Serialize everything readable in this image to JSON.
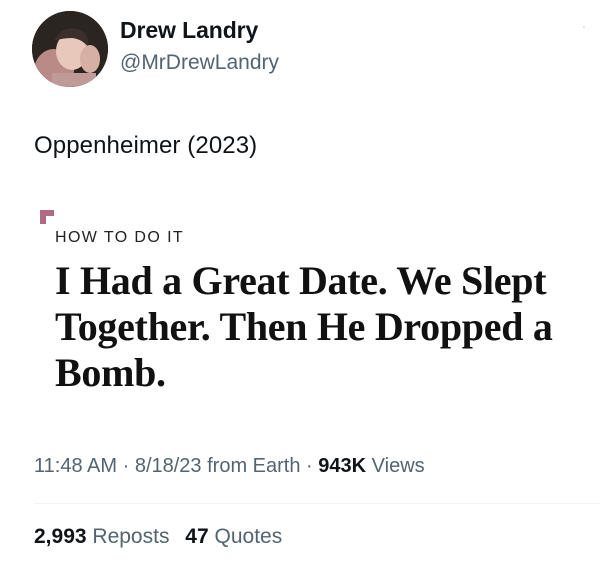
{
  "author": {
    "display_name": "Drew Landry",
    "handle": "@MrDrewLandry"
  },
  "tweet": {
    "text": "Oppenheimer (2023)"
  },
  "article": {
    "kicker": "HOW TO DO IT",
    "headline": "I Had a Great Date. We Slept Together. Then He Dropped a Bomb."
  },
  "meta": {
    "time": "11:48 AM",
    "date": "8/18/23",
    "source": "from Earth",
    "views_count": "943K",
    "views_label": "Views",
    "separator": "·"
  },
  "stats": {
    "reposts_count": "2,993",
    "reposts_label": "Reposts",
    "quotes_count": "47",
    "quotes_label": "Quotes"
  },
  "colors": {
    "kicker_mark": "#b06a82",
    "secondary_text": "#536471",
    "primary_text": "#0f1419"
  }
}
